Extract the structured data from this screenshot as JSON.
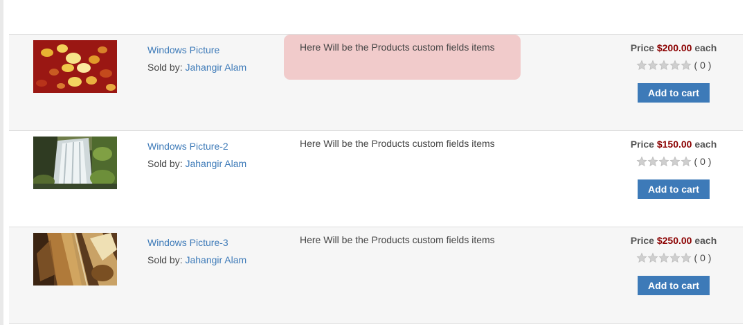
{
  "products": [
    {
      "title": "Windows Picture",
      "sold_by_label": "Sold by:",
      "seller": "Jahangir Alam",
      "custom_fields": "Here Will be the Products custom fields items",
      "price_label": "Price",
      "price": "$200.00",
      "each_label": "each",
      "rating_count": "( 0 )",
      "rating_value": 0,
      "rating_max": 5,
      "cart_label": "Add to cart",
      "image_semantic": "autumn-leaves-image"
    },
    {
      "title": "Windows Picture-2",
      "sold_by_label": "Sold by:",
      "seller": "Jahangir Alam",
      "custom_fields": "Here Will be the Products custom fields items",
      "price_label": "Price",
      "price": "$150.00",
      "each_label": "each",
      "rating_count": "( 0 )",
      "rating_value": 0,
      "rating_max": 5,
      "cart_label": "Add to cart",
      "image_semantic": "waterfall-image"
    },
    {
      "title": "Windows Picture-3",
      "sold_by_label": "Sold by:",
      "seller": "Jahangir Alam",
      "custom_fields": "Here Will be the Products custom fields items",
      "price_label": "Price",
      "price": "$250.00",
      "each_label": "each",
      "rating_count": "( 0 )",
      "rating_value": 0,
      "rating_max": 5,
      "cart_label": "Add to cart",
      "image_semantic": "abstract-glass-image"
    }
  ],
  "colors": {
    "link": "#3d7ab8",
    "price": "#8b0000",
    "button": "#3d7ab8",
    "highlight": "#f1cbcb",
    "row_alt": "#f6f6f6"
  }
}
